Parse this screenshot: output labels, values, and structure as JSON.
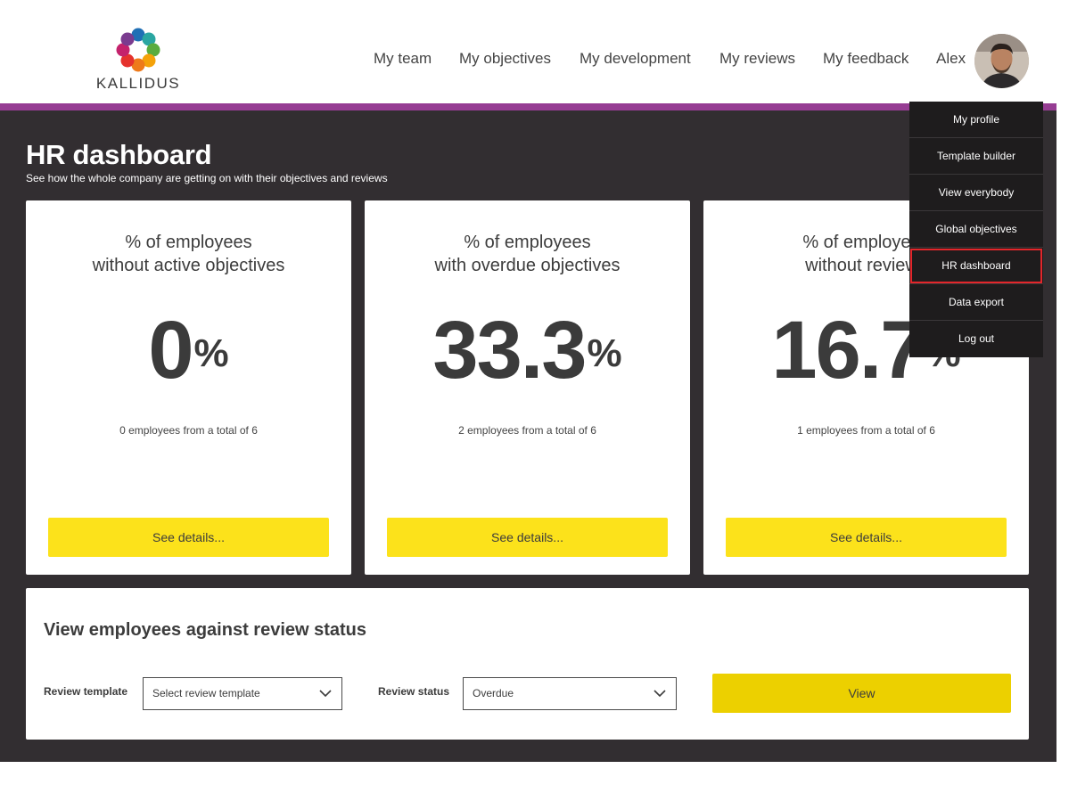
{
  "brand": {
    "name": "KALLIDUS"
  },
  "nav": {
    "items": [
      {
        "label": "My team"
      },
      {
        "label": "My objectives"
      },
      {
        "label": "My development"
      },
      {
        "label": "My reviews"
      },
      {
        "label": "My feedback"
      }
    ],
    "user_name": "Alex"
  },
  "dropdown": {
    "items": [
      {
        "label": "My profile"
      },
      {
        "label": "Template builder"
      },
      {
        "label": "View everybody"
      },
      {
        "label": "Global objectives"
      },
      {
        "label": "HR dashboard",
        "active": true
      },
      {
        "label": "Data export"
      },
      {
        "label": "Log out"
      }
    ]
  },
  "page": {
    "title": "HR dashboard",
    "subtitle": "See how the whole company are getting on with their objectives and reviews"
  },
  "cards": [
    {
      "title_line1": "% of employees",
      "title_line2": "without active objectives",
      "value": "0",
      "unit": "%",
      "summary": "0 employees from a total of 6",
      "button": "See details..."
    },
    {
      "title_line1": "% of employees",
      "title_line2": "with overdue objectives",
      "value": "33.3",
      "unit": "%",
      "summary": "2 employees from a total of 6",
      "button": "See details..."
    },
    {
      "title_line1": "% of employees",
      "title_line2": "without reviews",
      "value": "16.7",
      "unit": "%",
      "summary": "1 employees from a total of 6",
      "button": "See details..."
    }
  ],
  "review_panel": {
    "title": "View employees against review status",
    "template_label": "Review template",
    "template_value": "Select review template",
    "status_label": "Review status",
    "status_value": "Overdue",
    "view_button": "View"
  },
  "colors": {
    "accent_purple": "#963d93",
    "button_yellow": "#fce21b",
    "dark_background": "#322e31",
    "menu_background": "#1e1c1d",
    "active_outline": "#e3262b"
  }
}
